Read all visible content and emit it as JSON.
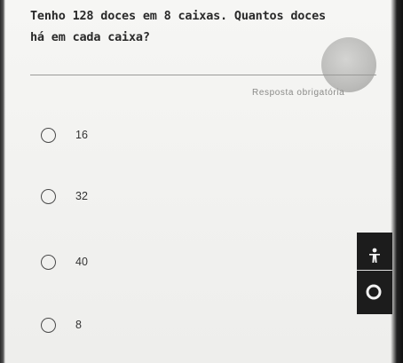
{
  "question": {
    "line1": "Tenho 128 doces em 8 caixas. Quantos doces",
    "line2": "há em cada caixa?"
  },
  "required_label": "Resposta obrigatória",
  "options": [
    {
      "label": "16"
    },
    {
      "label": "32"
    },
    {
      "label": "40"
    },
    {
      "label": "8"
    }
  ],
  "icons": {
    "avatar": "avatar-circle",
    "floating_person": "accessibility-person-icon",
    "floating_ring": "ring-icon"
  },
  "colors": {
    "background": "#f3f3f1",
    "text": "#2a2a2a",
    "floating_bar": "#1c1c1c"
  }
}
